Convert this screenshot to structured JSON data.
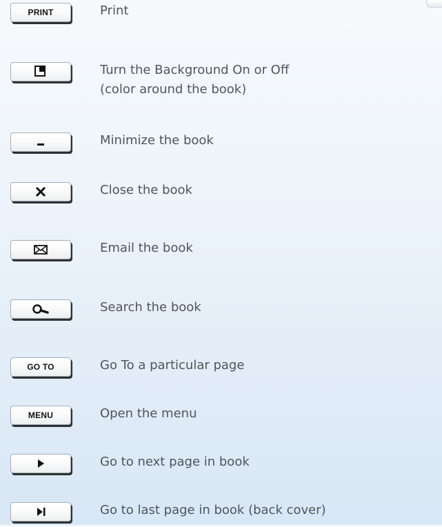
{
  "legend": {
    "items": [
      {
        "button_label": "PRINT",
        "icon": "print-text",
        "description": [
          "Print"
        ]
      },
      {
        "button_label": "",
        "icon": "background-toggle-icon",
        "description": [
          "Turn the Background On or Off",
          "(color around the book)"
        ]
      },
      {
        "button_label": "",
        "icon": "minimize-icon",
        "description": [
          "Minimize the book"
        ]
      },
      {
        "button_label": "",
        "icon": "close-icon",
        "description": [
          "Close the book"
        ]
      },
      {
        "button_label": "",
        "icon": "email-icon",
        "description": [
          "Email the book"
        ]
      },
      {
        "button_label": "",
        "icon": "search-icon",
        "description": [
          "Search the book"
        ]
      },
      {
        "button_label": "GO TO",
        "icon": "goto-text",
        "description": [
          "Go To a particular page"
        ]
      },
      {
        "button_label": "MENU",
        "icon": "menu-text",
        "description": [
          "Open the menu"
        ]
      },
      {
        "button_label": "",
        "icon": "next-page-icon",
        "description": [
          "Go to next page in book"
        ]
      },
      {
        "button_label": "",
        "icon": "last-page-icon",
        "description": [
          "Go to last page in book (back cover)"
        ]
      }
    ]
  }
}
